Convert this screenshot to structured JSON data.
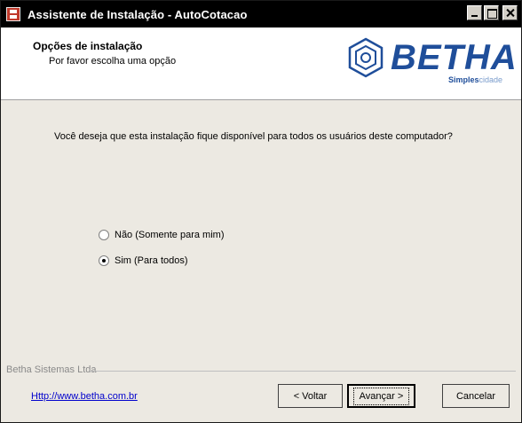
{
  "window": {
    "title": "Assistente de Instalação - AutoCotacao"
  },
  "header": {
    "title": "Opções de instalação",
    "subtitle": "Por favor escolha uma opção"
  },
  "logo": {
    "name": "BETHA",
    "tagline_strong": "Simples",
    "tagline_light": "cidade",
    "brand_color": "#1f4e9a"
  },
  "body": {
    "question": "Você deseja que esta instalação fique disponível para todos os usuários deste computador?",
    "options": [
      {
        "label": "Não (Somente para mim)",
        "selected": false
      },
      {
        "label": "Sim (Para todos)",
        "selected": true
      }
    ]
  },
  "footer": {
    "company": "Betha Sistemas Ltda",
    "link": "Http://www.betha.com.br",
    "back_label": "< Voltar",
    "next_label": "Avançar >",
    "cancel_label": "Cancelar"
  }
}
